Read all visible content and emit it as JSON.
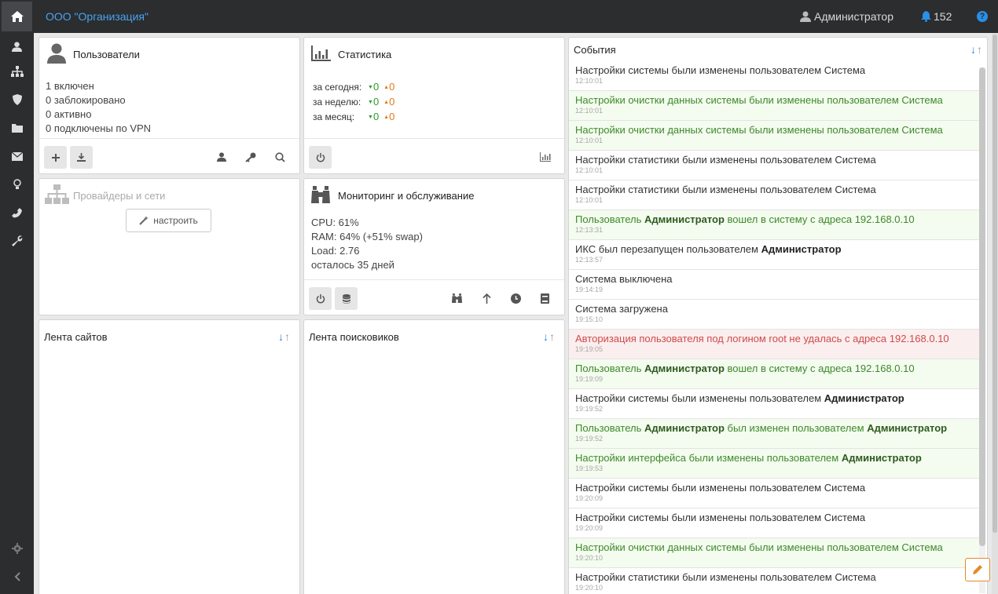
{
  "header": {
    "org_name": "ООО \"Организация\"",
    "user_name": "Администратор",
    "notifications_count": "152",
    "help_label": "?"
  },
  "sidebar": {
    "items": [
      "home-icon",
      "user-icon",
      "sitemap-icon",
      "shield-icon",
      "folder-icon",
      "envelope-icon",
      "lightbulb-icon",
      "phone-icon",
      "wrench-icon"
    ],
    "bottom": [
      "gear-icon",
      "collapse-chevron-icon"
    ]
  },
  "users_panel": {
    "title": "Пользователи",
    "lines": [
      "1 включен",
      "0 заблокировано",
      "0 активно",
      "0 подключены по VPN"
    ]
  },
  "stats_panel": {
    "title": "Статистика",
    "rows": [
      {
        "label": "за сегодня:",
        "up": "0",
        "down": "0"
      },
      {
        "label": "за неделю:",
        "up": "0",
        "down": "0"
      },
      {
        "label": "за месяц:",
        "up": "0",
        "down": "0"
      }
    ]
  },
  "providers_panel": {
    "title": "Провайдеры и сети",
    "configure_label": "настроить"
  },
  "monitoring_panel": {
    "title": "Мониторинг и обслуживание",
    "lines": [
      "CPU: 61%",
      "RAM: 64% (+51% swap)",
      "Load: 2.76",
      "осталось 35 дней"
    ]
  },
  "sites_feed": {
    "title": "Лента сайтов"
  },
  "search_feed": {
    "title": "Лента поисковиков"
  },
  "events_panel": {
    "title": "События",
    "items": [
      {
        "type": "normal",
        "text": "Настройки системы были изменены пользователем Система",
        "bold": "",
        "suffix": "",
        "time": "12:10:01"
      },
      {
        "type": "success",
        "text": "Настройки очистки данных системы были изменены пользователем Система",
        "bold": "",
        "suffix": "",
        "time": "12:10:01"
      },
      {
        "type": "success",
        "text": "Настройки очистки данных системы были изменены пользователем Система",
        "bold": "",
        "suffix": "",
        "time": "12:10:01"
      },
      {
        "type": "normal",
        "text": "Настройки статистики были изменены пользователем Система",
        "bold": "",
        "suffix": "",
        "time": "12:10:01"
      },
      {
        "type": "normal",
        "text": "Настройки статистики были изменены пользователем Система",
        "bold": "",
        "suffix": "",
        "time": "12:10:01"
      },
      {
        "type": "success",
        "text": "Пользователь ",
        "bold": "Администратор",
        "suffix": " вошел в систему с адреса 192.168.0.10",
        "time": "12:13:31"
      },
      {
        "type": "normal",
        "text": "ИКС был перезапущен пользователем ",
        "bold": "Администратор",
        "suffix": "",
        "time": "12:13:57"
      },
      {
        "type": "normal",
        "text": "Система выключена",
        "bold": "",
        "suffix": "",
        "time": "19:14:19"
      },
      {
        "type": "normal",
        "text": "Система загружена",
        "bold": "",
        "suffix": "",
        "time": "19:15:10"
      },
      {
        "type": "error",
        "text": "Авторизация пользователя под логином root не удалась с адреса 192.168.0.10",
        "bold": "",
        "suffix": "",
        "time": "19:19:05"
      },
      {
        "type": "success",
        "text": "Пользователь ",
        "bold": "Администратор",
        "suffix": " вошел в систему с адреса 192.168.0.10",
        "time": "19:19:09"
      },
      {
        "type": "normal",
        "text": "Настройки системы были изменены пользователем ",
        "bold": "Администратор",
        "suffix": "",
        "time": "19:19:52"
      },
      {
        "type": "success",
        "text": "Пользователь ",
        "bold": "Администратор",
        "suffix": " был изменен пользователем ",
        "bold2": "Администратор",
        "time": "19:19:52"
      },
      {
        "type": "success",
        "text": "Настройки интерфейса были изменены пользователем ",
        "bold": "Администратор",
        "suffix": "",
        "time": "19:19:53"
      },
      {
        "type": "normal",
        "text": "Настройки системы были изменены пользователем Система",
        "bold": "",
        "suffix": "",
        "time": "19:20:09"
      },
      {
        "type": "normal",
        "text": "Настройки системы были изменены пользователем Система",
        "bold": "",
        "suffix": "",
        "time": "19:20:09"
      },
      {
        "type": "success",
        "text": "Настройки очистки данных системы были изменены пользователем Система",
        "bold": "",
        "suffix": "",
        "time": "19:20:10"
      },
      {
        "type": "normal",
        "text": "Настройки статистики были изменены пользователем Система",
        "bold": "",
        "suffix": "",
        "time": "19:20:10"
      }
    ]
  }
}
